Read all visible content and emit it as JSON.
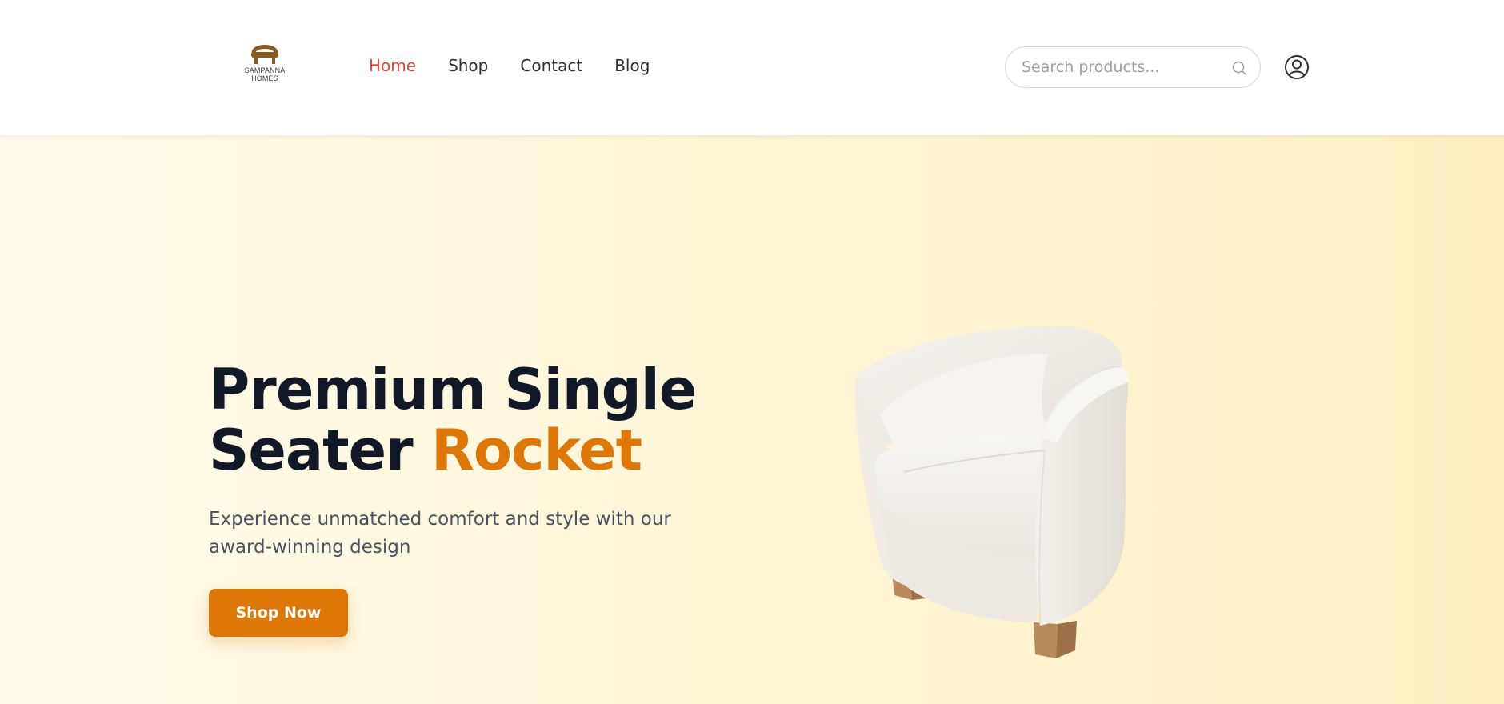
{
  "brand": {
    "logo_text_line1": "SAMPANNA",
    "logo_text_line2": "HOMES",
    "logo_color": "#8b5a22"
  },
  "nav": {
    "items": [
      {
        "label": "Home",
        "active": true
      },
      {
        "label": "Shop",
        "active": false
      },
      {
        "label": "Contact",
        "active": false
      },
      {
        "label": "Blog",
        "active": false
      }
    ],
    "active_color": "#e2483c"
  },
  "search": {
    "placeholder": "Search products...",
    "value": "",
    "icon": "search-icon"
  },
  "account": {
    "icon": "user-icon"
  },
  "hero": {
    "headline_part1": "Premium Single",
    "headline_part2": "Seater ",
    "headline_accent": "Rocket",
    "subtitle": "Experience unmatched comfort and style with our award-winning design",
    "cta_label": "Shop Now",
    "accent_color": "#dc7708",
    "image": "white-armchair"
  }
}
